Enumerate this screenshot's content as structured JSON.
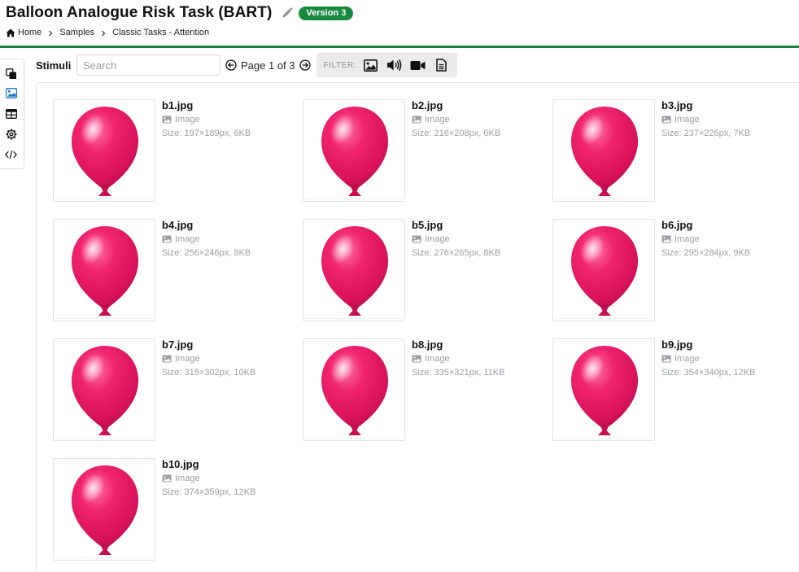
{
  "header": {
    "title": "Balloon Analogue Risk Task (BART)",
    "version_badge": "Version 3",
    "breadcrumb": [
      "Home",
      "Samples",
      "Classic Tasks - Attention"
    ],
    "accent_color": "#1e7e3e"
  },
  "sidebar": {
    "items": [
      "copy-icon",
      "image-icon",
      "table-icon",
      "gear-icon",
      "code-icon"
    ],
    "active": "image-icon"
  },
  "toolbar": {
    "stimuli_label": "Stimuli",
    "search_placeholder": "Search",
    "search_value": "",
    "page_text": "Page 1 of 3",
    "filter_label": "FILTER:",
    "filter_icons": [
      "image-icon",
      "audio-icon",
      "video-icon",
      "document-icon"
    ]
  },
  "files": [
    {
      "name": "b1.jpg",
      "type": "Image",
      "size": "Size: 197×189px, 6KB"
    },
    {
      "name": "b2.jpg",
      "type": "Image",
      "size": "Size: 216×208px, 6KB"
    },
    {
      "name": "b3.jpg",
      "type": "Image",
      "size": "Size: 237×226px, 7KB"
    },
    {
      "name": "b4.jpg",
      "type": "Image",
      "size": "Size: 256×246px, 8KB"
    },
    {
      "name": "b5.jpg",
      "type": "Image",
      "size": "Size: 276×265px, 8KB"
    },
    {
      "name": "b6.jpg",
      "type": "Image",
      "size": "Size: 295×284px, 9KB"
    },
    {
      "name": "b7.jpg",
      "type": "Image",
      "size": "Size: 315×302px, 10KB"
    },
    {
      "name": "b8.jpg",
      "type": "Image",
      "size": "Size: 335×321px, 11KB"
    },
    {
      "name": "b9.jpg",
      "type": "Image",
      "size": "Size: 354×340px, 12KB"
    },
    {
      "name": "b10.jpg",
      "type": "Image",
      "size": "Size: 374×359px, 12KB"
    }
  ],
  "colors": {
    "badge": "#198a3d",
    "balloon": "#e8175d",
    "muted_text": "#9a9ea3"
  }
}
